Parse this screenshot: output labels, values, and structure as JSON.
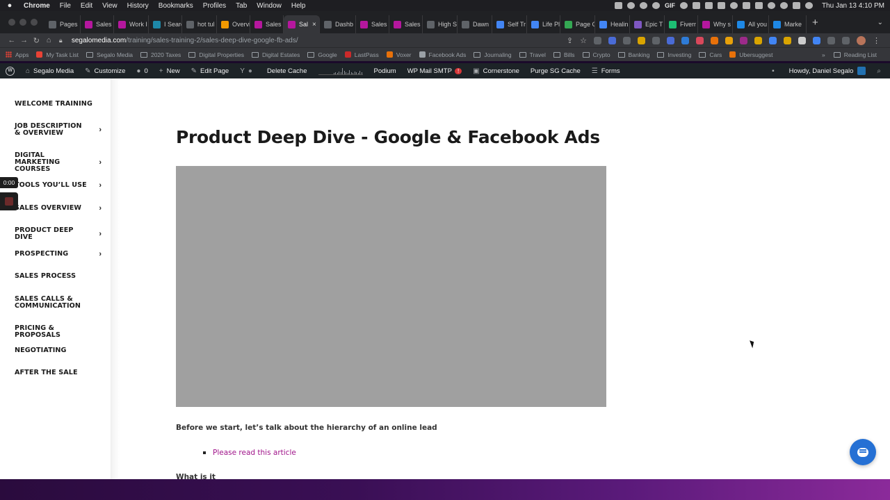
{
  "menubar": {
    "app": "Chrome",
    "items": [
      "File",
      "Edit",
      "View",
      "History",
      "Bookmarks",
      "Profiles",
      "Tab",
      "Window",
      "Help"
    ],
    "gif_label": "GIF",
    "clock": "Thu Jan 13  4:10 PM"
  },
  "tabs": [
    {
      "label": "Pages",
      "color": "#5f6368"
    },
    {
      "label": "Sales",
      "color": "#b5179e"
    },
    {
      "label": "Work I",
      "color": "#b5179e"
    },
    {
      "label": "I Searc",
      "color": "#1e88a8"
    },
    {
      "label": "hot tul",
      "color": "#5f6368"
    },
    {
      "label": "Overvi",
      "color": "#f29900"
    },
    {
      "label": "Sales",
      "color": "#b5179e"
    },
    {
      "label": "Sal",
      "color": "#b5179e",
      "active": true
    },
    {
      "label": "Dashb",
      "color": "#5f6368"
    },
    {
      "label": "Sales",
      "color": "#b5179e"
    },
    {
      "label": "Sales",
      "color": "#b5179e"
    },
    {
      "label": "High S",
      "color": "#5f6368"
    },
    {
      "label": "Dawn",
      "color": "#5f6368"
    },
    {
      "label": "Self Tr",
      "color": "#4285f4"
    },
    {
      "label": "Life Pl",
      "color": "#4285f4"
    },
    {
      "label": "Page C",
      "color": "#34a853"
    },
    {
      "label": "Healin",
      "color": "#4285f4"
    },
    {
      "label": "Epic T",
      "color": "#7e57c2"
    },
    {
      "label": "Fiverr",
      "color": "#1dbf73"
    },
    {
      "label": "Why s",
      "color": "#b5179e"
    },
    {
      "label": "All you",
      "color": "#1e88e5"
    },
    {
      "label": "Marke",
      "color": "#1e88e5"
    }
  ],
  "tab_close": "×",
  "new_tab": "+",
  "address": {
    "host": "segalomedia.com",
    "path": "/training/sales-training-2/sales-deep-dive-google-fb-ads/"
  },
  "bookmarks": {
    "apps": "Apps",
    "items": [
      {
        "label": "My Task List",
        "kind": "dot",
        "color": "#e94235"
      },
      {
        "label": "Segalo Media",
        "kind": "folder"
      },
      {
        "label": "2020 Taxes",
        "kind": "folder"
      },
      {
        "label": "Digital Properties",
        "kind": "folder"
      },
      {
        "label": "Digital Estates",
        "kind": "folder"
      },
      {
        "label": "Google",
        "kind": "folder"
      },
      {
        "label": "LastPass",
        "kind": "dot",
        "color": "#cc2a2a"
      },
      {
        "label": "Voxer",
        "kind": "dot",
        "color": "#e8710a"
      },
      {
        "label": "Facebook Ads",
        "kind": "dot",
        "color": "#9aa0a6"
      },
      {
        "label": "Journaling",
        "kind": "folder"
      },
      {
        "label": "Travel",
        "kind": "folder"
      },
      {
        "label": "Bills",
        "kind": "folder"
      },
      {
        "label": "Crypto",
        "kind": "folder"
      },
      {
        "label": "Banking",
        "kind": "folder"
      },
      {
        "label": "Investing",
        "kind": "folder"
      },
      {
        "label": "Cars",
        "kind": "folder"
      },
      {
        "label": "Ubersuggest",
        "kind": "dot",
        "color": "#e8710a"
      }
    ],
    "more": "»",
    "reading_list": "Reading List"
  },
  "wpbar": {
    "wp_logo": "W",
    "site": "Segalo Media",
    "customize": "Customize",
    "comments": "0",
    "new": "New",
    "edit_page": "Edit Page",
    "yoast": "Y",
    "delete_cache": "Delete Cache",
    "podium": "Podium",
    "wp_mail": "WP Mail SMTP",
    "wp_mail_badge": "!",
    "cornerstone": "Cornerstone",
    "purge": "Purge SG Cache",
    "forms": "Forms",
    "howdy": "Howdy, Daniel Segalo"
  },
  "sidebar": [
    {
      "label": "WELCOME TRAINING",
      "chevron": false
    },
    {
      "label": "JOB DESCRIPTION & OVERVIEW",
      "chevron": true
    },
    {
      "label": "DIGITAL MARKETING COURSES",
      "chevron": true
    },
    {
      "label": "TOOLS YOU’LL USE",
      "chevron": true
    },
    {
      "label": "SALES OVERVIEW",
      "chevron": true
    },
    {
      "label": "PRODUCT DEEP DIVE",
      "chevron": true
    },
    {
      "label": "PROSPECTING",
      "chevron": true
    },
    {
      "label": "SALES PROCESS",
      "chevron": false
    },
    {
      "label": "SALES CALLS & COMMUNICATION",
      "chevron": false
    },
    {
      "label": "PRICING & PROPOSALS",
      "chevron": false
    },
    {
      "label": "NEGOTIATING",
      "chevron": false
    },
    {
      "label": "AFTER THE SALE",
      "chevron": false
    }
  ],
  "recorder": {
    "time": "0:00"
  },
  "content": {
    "title": "Product Deep Dive - Google & Facebook Ads",
    "intro": "Before we start, let’s talk about the hierarchy of an online lead",
    "link": "Please read this article",
    "next_heading": "What is it"
  },
  "colors": {
    "link": "#a0148a",
    "chat_button": "#2570d4",
    "video_placeholder": "#a0a0a0"
  }
}
